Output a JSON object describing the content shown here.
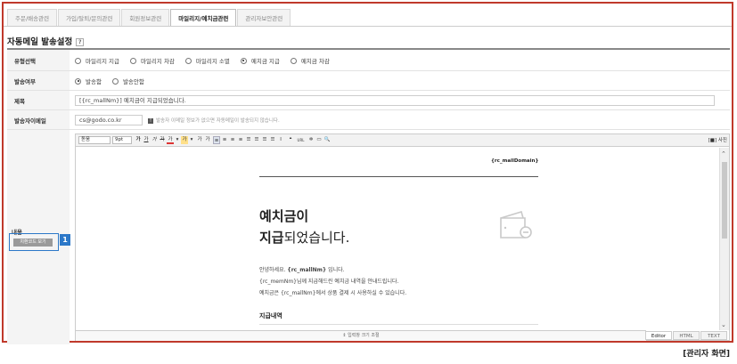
{
  "tabs": [
    {
      "label": "주문/배송관련",
      "active": false
    },
    {
      "label": "가입/탈퇴/문의관련",
      "active": false
    },
    {
      "label": "회원정보관련",
      "active": false
    },
    {
      "label": "마일리지/예치금관련",
      "active": true
    },
    {
      "label": "관리자보안관련",
      "active": false
    }
  ],
  "section": {
    "title": "자동메일 발송설정",
    "help": "?"
  },
  "form": {
    "type": {
      "label": "유형선택",
      "options": [
        {
          "label": "마일리지 지급",
          "checked": false
        },
        {
          "label": "마일리지 차감",
          "checked": false
        },
        {
          "label": "마일리지 소멸",
          "checked": false
        },
        {
          "label": "예치금 지급",
          "checked": true
        },
        {
          "label": "예치금 차감",
          "checked": false
        }
      ]
    },
    "send": {
      "label": "발송여부",
      "options": [
        {
          "label": "발송함",
          "checked": true
        },
        {
          "label": "발송안함",
          "checked": false
        }
      ]
    },
    "subject": {
      "label": "제목",
      "value": "[{rc_mallNm}] 예치금이 지급되었습니다."
    },
    "sender": {
      "label": "발송자이메일",
      "value": "cs@godo.co.kr",
      "hint_mark": "!",
      "hint": "발송자 이메일 정보가 없으면 자동메일이 발송되지 않습니다."
    },
    "content": {
      "label": "내용",
      "code_button": "치환코드 보기"
    }
  },
  "editor": {
    "font_family": "돋움",
    "font_size": "9pt",
    "source_label": "[■] 사진",
    "toolbar_buttons": [
      "가",
      "가",
      "가",
      "가",
      "가",
      "▾",
      "가",
      "▾",
      "가",
      "가",
      "≡",
      "≡",
      "≡",
      "≡",
      "☰",
      "☰",
      "☰",
      "☰",
      "I",
      "❝",
      "URL",
      "✲",
      "▭",
      "🔍"
    ],
    "document": {
      "domain": "{rc_mallDomain}",
      "heading_line1": "예치금이",
      "heading_line2_bold": "지급",
      "heading_line2_rest": "되었습니다.",
      "greeting_prefix": "안녕하세요. ",
      "greeting_name": "{rc_mallNm}",
      "greeting_suffix": " 입니다.",
      "para2": "{rc_memNm}님께 지급해드린 예치금 내역을 안내드립니다.",
      "para3": "예치금은 {rc_mallNm}에서 상품 결제 시 사용하실 수 있습니다.",
      "sub_heading": "지급내역"
    },
    "resize_label": "⇕ 입력창 크기 조절",
    "modes": [
      {
        "label": "Editor",
        "active": true
      },
      {
        "label": "HTML",
        "active": false
      },
      {
        "label": "TEXT",
        "active": false
      }
    ]
  },
  "callout": {
    "number": "1"
  },
  "caption": "[관리자 화면]",
  "colors": {
    "frame": "#c0392b",
    "callout": "#2c78c8"
  }
}
